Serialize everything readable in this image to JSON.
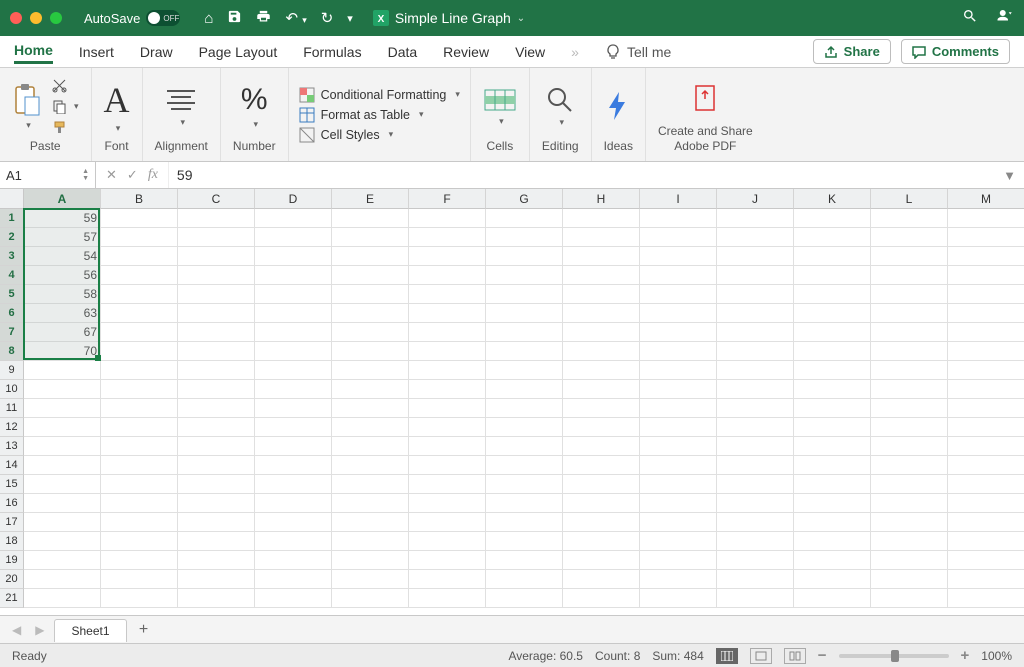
{
  "titlebar": {
    "autosave_label": "AutoSave",
    "autosave_state": "OFF",
    "doc_name": "Simple Line Graph"
  },
  "tabs": {
    "items": [
      "Home",
      "Insert",
      "Draw",
      "Page Layout",
      "Formulas",
      "Data",
      "Review",
      "View"
    ],
    "active": "Home",
    "tell_me": "Tell me",
    "share": "Share",
    "comments": "Comments"
  },
  "ribbon": {
    "paste": "Paste",
    "font": "Font",
    "alignment": "Alignment",
    "number": "Number",
    "cond_fmt": "Conditional Formatting",
    "fmt_table": "Format as Table",
    "cell_styles": "Cell Styles",
    "cells": "Cells",
    "editing": "Editing",
    "ideas": "Ideas",
    "share_pdf_l1": "Create and Share",
    "share_pdf_l2": "Adobe PDF"
  },
  "formula_bar": {
    "name_box": "A1",
    "fx": "fx",
    "value": "59"
  },
  "grid": {
    "columns": [
      "A",
      "B",
      "C",
      "D",
      "E",
      "F",
      "G",
      "H",
      "I",
      "J",
      "K",
      "L",
      "M"
    ],
    "row_count": 21,
    "col_a_values": [
      59,
      57,
      54,
      56,
      58,
      63,
      67,
      70
    ],
    "selection": {
      "col": "A",
      "r1": 1,
      "r2": 8
    }
  },
  "sheetbar": {
    "active_sheet": "Sheet1"
  },
  "status": {
    "ready": "Ready",
    "avg_label": "Average:",
    "avg": "60.5",
    "count_label": "Count:",
    "count": "8",
    "sum_label": "Sum:",
    "sum": "484",
    "zoom": "100%"
  }
}
